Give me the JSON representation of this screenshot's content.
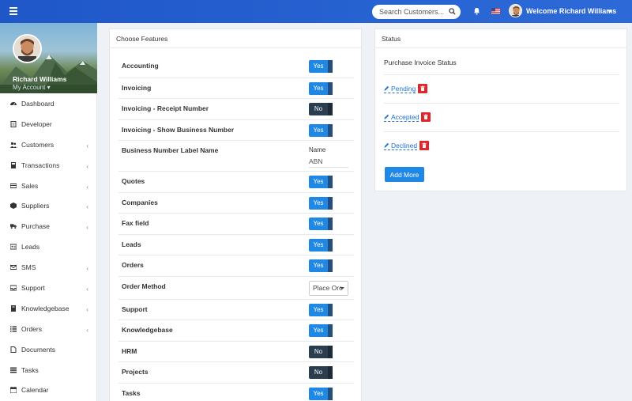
{
  "topbar": {
    "search_placeholder": "Search Customers...",
    "welcome": "Welcome Richard Williams",
    "icons": [
      "menu-icon",
      "search-icon",
      "bell-icon",
      "us-flag-icon",
      "avatar"
    ]
  },
  "sidebar": {
    "user_name": "Richard Williams",
    "account_label": "My Account",
    "items": [
      {
        "label": "Dashboard",
        "icon": "dashboard-icon",
        "has_submenu": false
      },
      {
        "label": "Developer",
        "icon": "document-icon",
        "has_submenu": false
      },
      {
        "label": "Customers",
        "icon": "users-icon",
        "has_submenu": true
      },
      {
        "label": "Transactions",
        "icon": "calculator-icon",
        "has_submenu": true
      },
      {
        "label": "Sales",
        "icon": "credit-card-icon",
        "has_submenu": true
      },
      {
        "label": "Suppliers",
        "icon": "cube-icon",
        "has_submenu": true
      },
      {
        "label": "Purchase",
        "icon": "truck-icon",
        "has_submenu": true
      },
      {
        "label": "Leads",
        "icon": "id-card-icon",
        "has_submenu": false
      },
      {
        "label": "SMS",
        "icon": "envelope-icon",
        "has_submenu": true
      },
      {
        "label": "Support",
        "icon": "inbox-icon",
        "has_submenu": true
      },
      {
        "label": "Knowledgebase",
        "icon": "book-icon",
        "has_submenu": true
      },
      {
        "label": "Orders",
        "icon": "list-icon",
        "has_submenu": true
      },
      {
        "label": "Documents",
        "icon": "file-icon",
        "has_submenu": false
      },
      {
        "label": "Tasks",
        "icon": "tasks-icon",
        "has_submenu": false
      },
      {
        "label": "Calendar",
        "icon": "calendar-icon",
        "has_submenu": false
      }
    ]
  },
  "features": {
    "title": "Choose Features",
    "rows": [
      {
        "label": "Accounting",
        "type": "toggle",
        "value": "Yes",
        "on": true
      },
      {
        "label": "Invoicing",
        "type": "toggle",
        "value": "Yes",
        "on": true
      },
      {
        "label": "Invoicing - Receipt Number",
        "type": "toggle",
        "value": "No",
        "on": false
      },
      {
        "label": "Invoicing - Show Business Number",
        "type": "toggle",
        "value": "Yes",
        "on": true
      },
      {
        "label": "Business Number Label Name",
        "type": "text",
        "field_label": "Name",
        "value": "ABN"
      },
      {
        "label": "Quotes",
        "type": "toggle",
        "value": "Yes",
        "on": true
      },
      {
        "label": "Companies",
        "type": "toggle",
        "value": "Yes",
        "on": true
      },
      {
        "label": "Fax field",
        "type": "toggle",
        "value": "Yes",
        "on": true
      },
      {
        "label": "Leads",
        "type": "toggle",
        "value": "Yes",
        "on": true
      },
      {
        "label": "Orders",
        "type": "toggle",
        "value": "Yes",
        "on": true
      },
      {
        "label": "Order Method",
        "type": "select",
        "value": "Place Orc"
      },
      {
        "label": "Support",
        "type": "toggle",
        "value": "Yes",
        "on": true
      },
      {
        "label": "Knowledgebase",
        "type": "toggle",
        "value": "Yes",
        "on": true
      },
      {
        "label": "HRM",
        "type": "toggle",
        "value": "No",
        "on": false
      },
      {
        "label": "Projects",
        "type": "toggle",
        "value": "No",
        "on": false
      },
      {
        "label": "Tasks",
        "type": "toggle",
        "value": "Yes",
        "on": true
      }
    ]
  },
  "status": {
    "title": "Status",
    "subtitle": "Purchase Invoice Status",
    "items": [
      "Pending",
      "Accepted",
      "Declined"
    ],
    "add_more": "Add More"
  },
  "colors": {
    "topbar": "#2a5fcf",
    "toggle_on": "#1f88e5",
    "toggle_off": "#2b3e50",
    "delete": "#e0262b",
    "link": "#1f6fd1"
  }
}
